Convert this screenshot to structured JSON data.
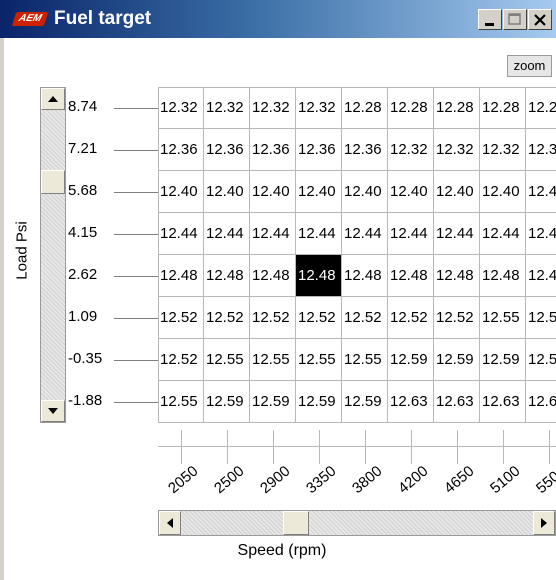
{
  "window": {
    "title": "Fuel target",
    "logo_text": "AEM",
    "buttons": {
      "minimize": "minimize-icon",
      "maximize": "maximize-icon",
      "close": "close-icon"
    }
  },
  "toolbar": {
    "zoom_label": "zoom"
  },
  "axes": {
    "y_label": "Load Psi",
    "x_label": "Speed (rpm)",
    "y_ticks": [
      "8.74",
      "7.21",
      "5.68",
      "4.15",
      "2.62",
      "1.09",
      "-0.35",
      "-1.88"
    ],
    "x_ticks": [
      "2050",
      "2500",
      "2900",
      "3350",
      "3800",
      "4200",
      "4650",
      "5100",
      "550"
    ]
  },
  "table": {
    "rows": [
      [
        "12.32",
        "12.32",
        "12.32",
        "12.32",
        "12.28",
        "12.28",
        "12.28",
        "12.28",
        "12.2"
      ],
      [
        "12.36",
        "12.36",
        "12.36",
        "12.36",
        "12.36",
        "12.32",
        "12.32",
        "12.32",
        "12.3"
      ],
      [
        "12.40",
        "12.40",
        "12.40",
        "12.40",
        "12.40",
        "12.40",
        "12.40",
        "12.40",
        "12.4"
      ],
      [
        "12.44",
        "12.44",
        "12.44",
        "12.44",
        "12.44",
        "12.44",
        "12.44",
        "12.44",
        "12.4"
      ],
      [
        "12.48",
        "12.48",
        "12.48",
        "12.48",
        "12.48",
        "12.48",
        "12.48",
        "12.48",
        "12.4"
      ],
      [
        "12.52",
        "12.52",
        "12.52",
        "12.52",
        "12.52",
        "12.52",
        "12.52",
        "12.55",
        "12.5"
      ],
      [
        "12.52",
        "12.55",
        "12.55",
        "12.55",
        "12.55",
        "12.59",
        "12.59",
        "12.59",
        "12.5"
      ],
      [
        "12.55",
        "12.59",
        "12.59",
        "12.59",
        "12.59",
        "12.63",
        "12.63",
        "12.63",
        "12.6"
      ]
    ],
    "selected": {
      "row": 4,
      "col": 3
    }
  },
  "colors": {
    "titlebar_start": "#0a246a",
    "titlebar_end": "#a6caf0",
    "selected_bg": "#000000",
    "selected_fg": "#ffffff"
  }
}
